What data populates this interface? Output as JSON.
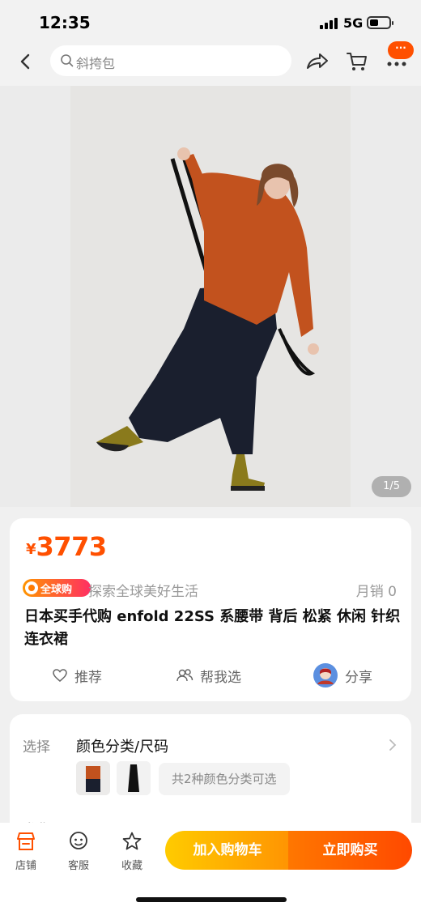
{
  "status_bar": {
    "time": "12:35",
    "network": "5G"
  },
  "nav": {
    "search_placeholder": "斜挎包",
    "more_badge": "···"
  },
  "gallery": {
    "page_indicator": "1/5"
  },
  "product": {
    "currency": "¥",
    "price": "3773",
    "badge": "全球购",
    "slogan": "探索全球美好生活",
    "sales": "月销  0",
    "title": "日本买手代购 enfold 22SS 系腰带 背后 松紧 休闲 针织 连衣裙",
    "actions": {
      "recommend": "推荐",
      "help_choose": "帮我选",
      "share": "分享"
    }
  },
  "options": {
    "select_label": "选择",
    "select_value": "颜色分类/尺码",
    "variants_text": "共2种颜色分类可选",
    "ship_label": "发货"
  },
  "bottom_bar": {
    "shop": "店铺",
    "service": "客服",
    "favorite": "收藏",
    "add_to_cart": "加入购物车",
    "buy_now": "立即购买"
  },
  "colors": {
    "accent": "#ff5000",
    "cart_button": "#ffb000",
    "buy_button": "#ff5a00"
  }
}
